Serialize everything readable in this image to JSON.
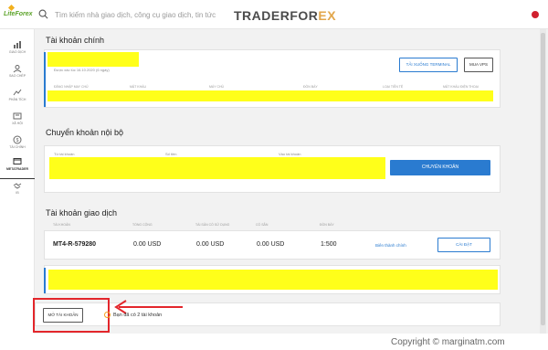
{
  "brand": {
    "logo_text": "LiteForex"
  },
  "search": {
    "placeholder": "Tìm kiếm nhà giao dịch, công cụ giao dịch, tin tức"
  },
  "watermark": {
    "main": "TRADERFOR",
    "accent": "EX"
  },
  "sidebar": {
    "items": [
      {
        "label": "GIAO DỊCH",
        "icon": "chart-bar-icon"
      },
      {
        "label": "SAO CHÉP",
        "icon": "copy-trade-icon"
      },
      {
        "label": "PHÂN TÍCH",
        "icon": "analytics-icon"
      },
      {
        "label": "XÃ HỘI",
        "icon": "social-icon"
      },
      {
        "label": "TÀI CHÍNH",
        "icon": "finance-icon"
      },
      {
        "label": "METATRADER",
        "icon": "metatrader-icon"
      },
      {
        "label": "IB",
        "icon": "handshake-icon"
      }
    ]
  },
  "main_account": {
    "title": "Tài khoản chính",
    "verified_text": "Được xác lúc 16.10.2020 (6 ngày)",
    "btn_download": "TẢI XUỐNG TERMINAL",
    "btn_vps": "MUA VPS",
    "columns": [
      "ĐĂNG NHẬP MAY CHỦ",
      "MẬT KHẨU",
      "MÁY CHỦ",
      "ĐÒN BẨY",
      "LOẠI TIỀN TỆ",
      "MẬT KHẨU ĐIỆN THOẠI"
    ]
  },
  "internal_transfer": {
    "title": "Chuyển khoản nội bộ",
    "labels": [
      "Từ tài khoản",
      "Số tiền",
      "Vào tài khoản"
    ],
    "btn_transfer": "CHUYỂN KHOẢN"
  },
  "trading_accounts": {
    "title": "Tài khoản giao dịch",
    "columns": [
      "TÀI KHOẢN",
      "TỔNG CỘNG",
      "TÀI SẢN CÓ SỬ DỤNG",
      "CÓ SẴN",
      "ĐÒN BẨY"
    ],
    "rows": [
      {
        "account": "MT4-R-579280",
        "total": "0.00 USD",
        "used": "0.00 USD",
        "available": "0.00 USD",
        "leverage": "1:500",
        "edit_link": "Biên thành chính",
        "settings": "CÀI ĐẶT"
      }
    ]
  },
  "open_account": {
    "btn_open": "MỞ TÀI KHOẢN",
    "info": "Bạn đã có 2 tài khoản"
  },
  "footer": {
    "copyright": "Copyright © marginatm.com"
  },
  "colors": {
    "accent_blue": "#2a7bd0",
    "highlight": "#ffff1a",
    "annotation_red": "#e3262b"
  }
}
